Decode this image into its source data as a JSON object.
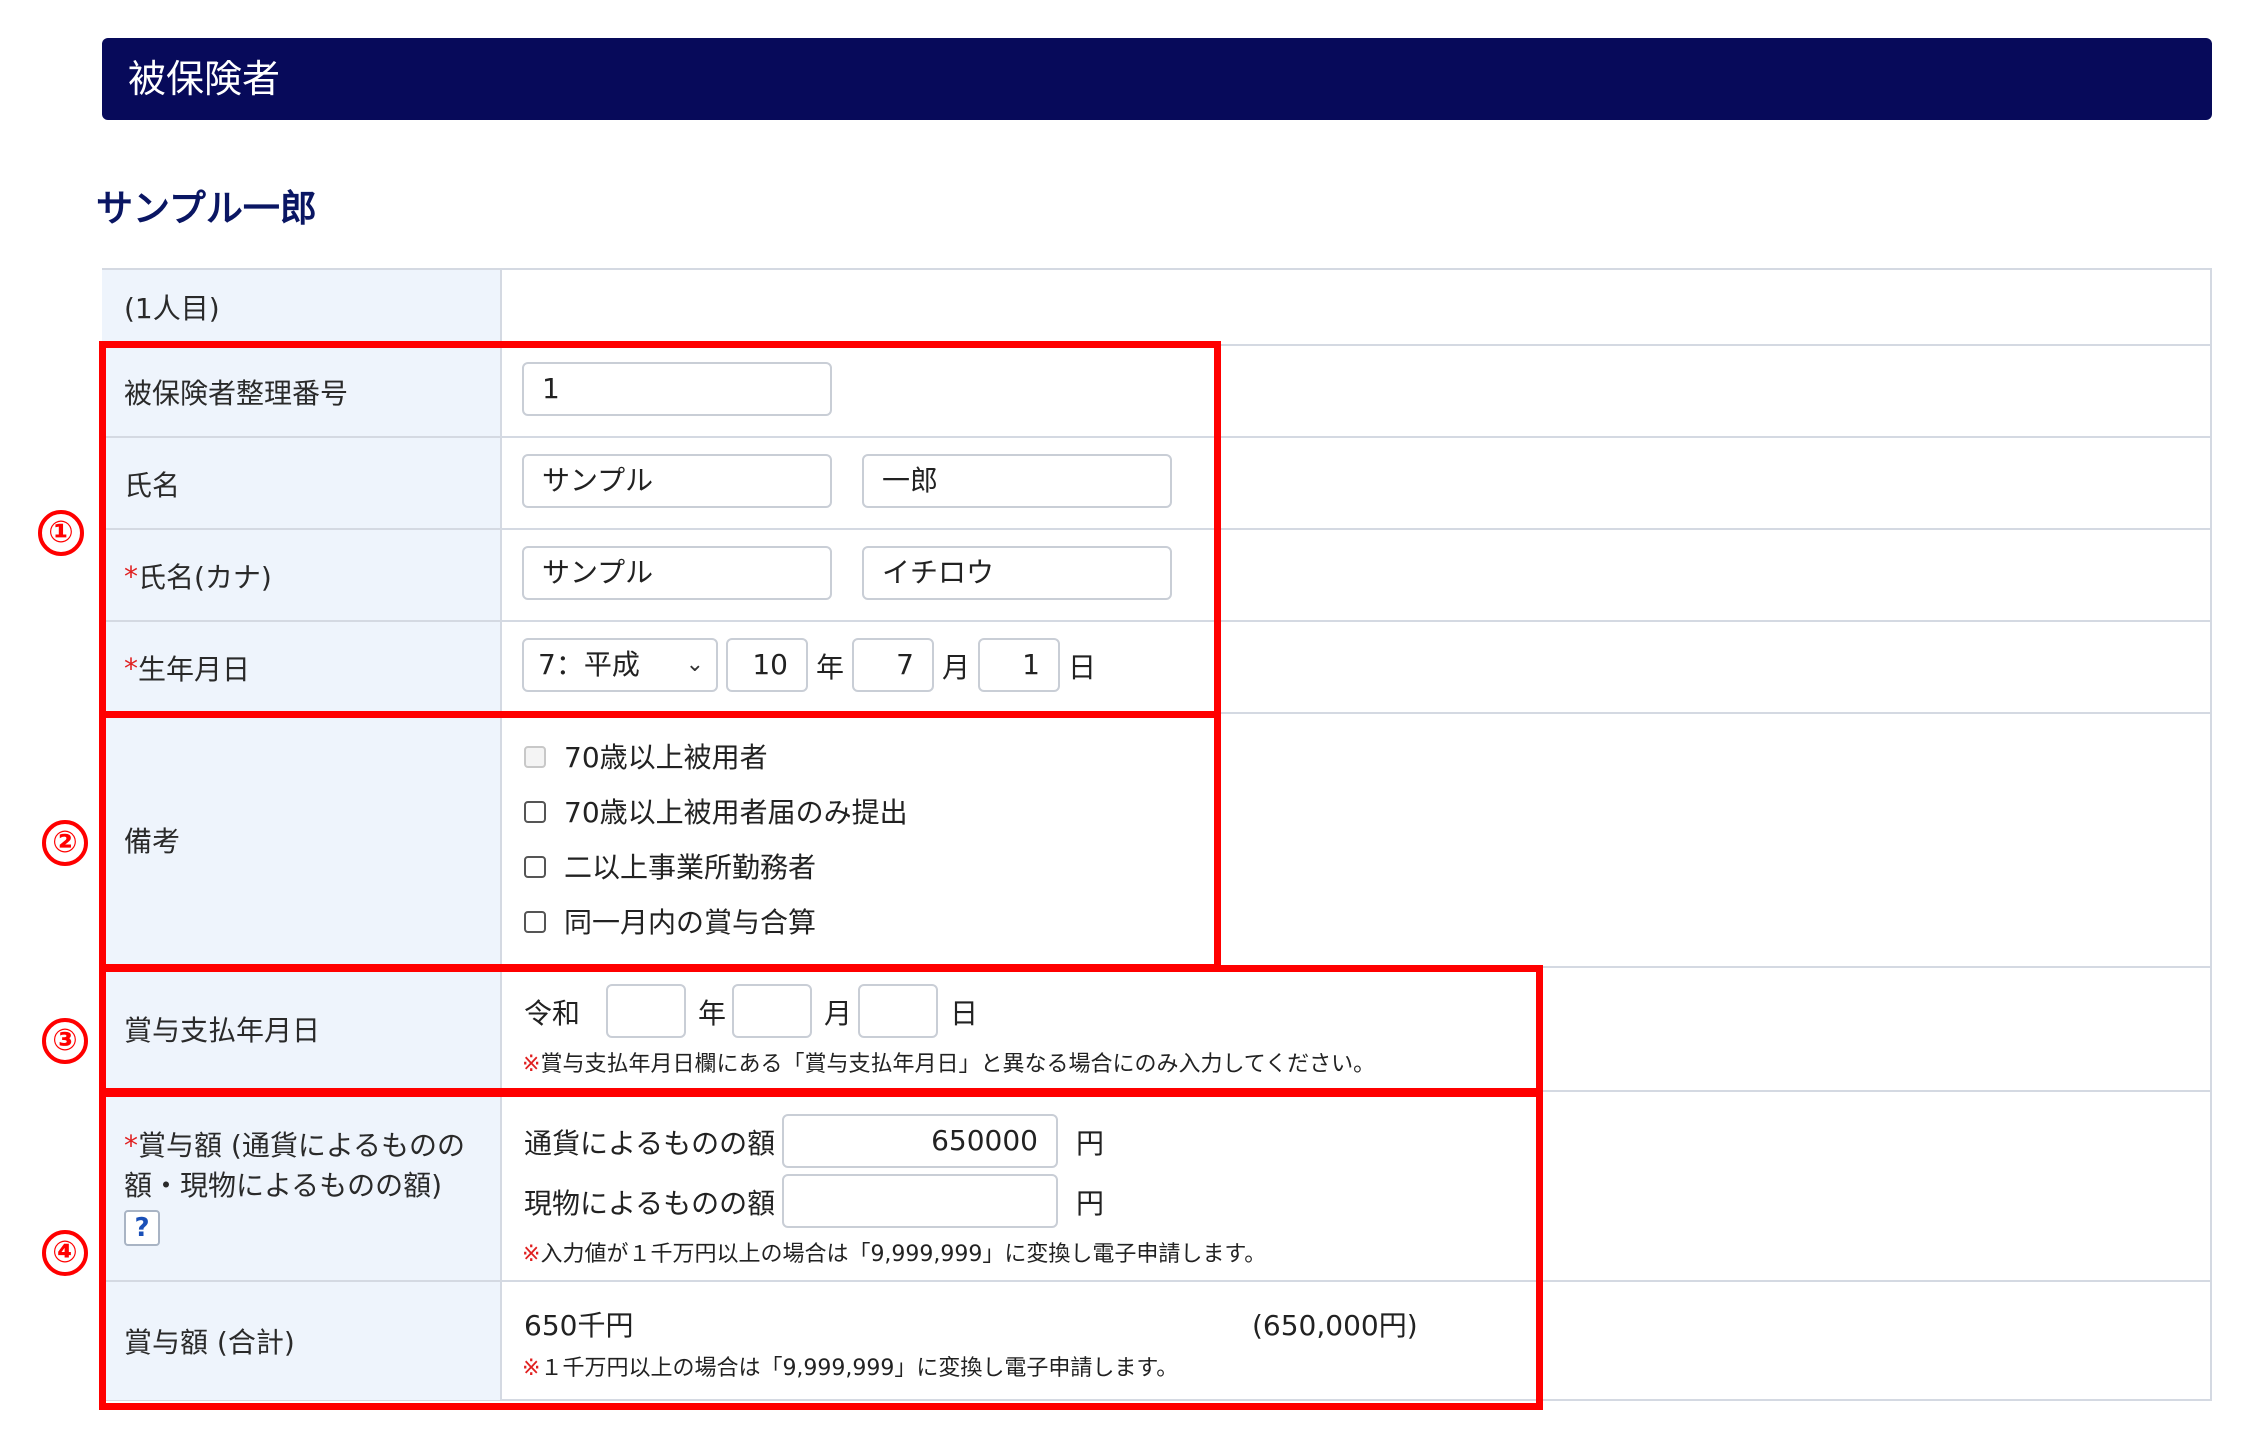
{
  "header": {
    "title": "被保険者"
  },
  "person": {
    "name": "サンプル一郎"
  },
  "form": {
    "index_label": "(1人目)",
    "seiri": {
      "label": "被保険者整理番号",
      "value": "1"
    },
    "name": {
      "label": "氏名",
      "last": "サンプル",
      "first": "一郎"
    },
    "kana": {
      "req": "*",
      "label": "氏名(カナ)",
      "last": "サンプル",
      "first": "イチロウ"
    },
    "birth": {
      "req": "*",
      "label": "生年月日",
      "era": "7：平成",
      "year": "10",
      "year_unit": "年",
      "month": "7",
      "month_unit": "月",
      "day": "1",
      "day_unit": "日"
    },
    "remarks": {
      "label": "備考",
      "options": [
        "70歳以上被用者",
        "70歳以上被用者届のみ提出",
        "二以上事業所勤務者",
        "同一月内の賞与合算"
      ]
    },
    "payday": {
      "label": "賞与支払年月日",
      "era": "令和",
      "year": "",
      "year_unit": "年",
      "month": "",
      "month_unit": "月",
      "day": "",
      "day_unit": "日",
      "note_mark": "※",
      "note": "賞与支払年月日欄にある「賞与支払年月日」と異なる場合にのみ入力してください。"
    },
    "amount": {
      "req": "*",
      "label_line1": "賞与額 (通貨によるものの",
      "label_line2": "額・現物によるものの額)",
      "help": "?",
      "currency_label": "通貨によるものの額",
      "currency_value": "650000",
      "currency_unit": "円",
      "kind_label": "現物によるものの額",
      "kind_value": "",
      "kind_unit": "円",
      "note_mark": "※",
      "note": "入力値が１千万円以上の場合は「9,999,999」に変換し電子申請します。"
    },
    "total": {
      "label": "賞与額 (合計)",
      "thousand": "650千円",
      "yen": "(650,000円)",
      "note_mark": "※",
      "note": "１千万円以上の場合は「9,999,999」に変換し電子申請します。"
    }
  },
  "annotations": {
    "markers": [
      "①",
      "②",
      "③",
      "④"
    ],
    "color": "#ff0000"
  },
  "colors": {
    "banner": "#070a5a",
    "label_bg": "#eef4fc",
    "name_title": "#0a1663",
    "required": "#e02020"
  }
}
